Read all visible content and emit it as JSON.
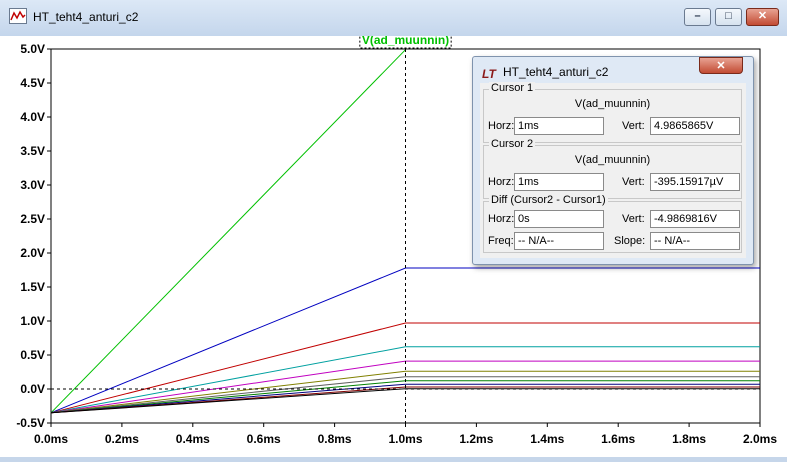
{
  "window": {
    "title": "HT_teht4_anturi_c2",
    "icon": "waveform-icon",
    "minimize_glyph": "–",
    "maximize_glyph": "□",
    "close_glyph": "✕"
  },
  "plot": {
    "trace_label": "V(ad_muunnin)",
    "trace_label_color": "#00c000",
    "cursor_x": 1.0,
    "cursor_y": 0.0
  },
  "chart_data": {
    "type": "line",
    "x_ticks": [
      "0.0ms",
      "0.2ms",
      "0.4ms",
      "0.6ms",
      "0.8ms",
      "1.0ms",
      "1.2ms",
      "1.4ms",
      "1.6ms",
      "1.8ms",
      "2.0ms"
    ],
    "y_ticks": [
      "5.0V",
      "4.5V",
      "4.0V",
      "3.5V",
      "3.0V",
      "2.5V",
      "2.0V",
      "1.5V",
      "1.0V",
      "0.5V",
      "0.0V",
      "-0.5V"
    ],
    "xlim": [
      0,
      2
    ],
    "ylim": [
      -0.5,
      5
    ],
    "x_unit": "ms",
    "y_unit": "V",
    "series": [
      {
        "color": "#00c000",
        "points": [
          [
            0,
            -0.35
          ],
          [
            1.0,
            4.99
          ]
        ]
      },
      {
        "color": "#0000c0",
        "points": [
          [
            0,
            -0.35
          ],
          [
            1.0,
            1.78
          ],
          [
            2.0,
            1.78
          ]
        ]
      },
      {
        "color": "#c00000",
        "points": [
          [
            0,
            -0.35
          ],
          [
            1.0,
            0.97
          ],
          [
            2.0,
            0.97
          ]
        ]
      },
      {
        "color": "#00a0a0",
        "points": [
          [
            0,
            -0.35
          ],
          [
            1.0,
            0.62
          ],
          [
            2.0,
            0.62
          ]
        ]
      },
      {
        "color": "#c000c0",
        "points": [
          [
            0,
            -0.35
          ],
          [
            1.0,
            0.41
          ],
          [
            2.0,
            0.41
          ]
        ]
      },
      {
        "color": "#808000",
        "points": [
          [
            0,
            -0.35
          ],
          [
            1.0,
            0.26
          ],
          [
            2.0,
            0.26
          ]
        ]
      },
      {
        "color": "#606060",
        "points": [
          [
            0,
            -0.35
          ],
          [
            1.0,
            0.18
          ],
          [
            2.0,
            0.18
          ]
        ]
      },
      {
        "color": "#008000",
        "points": [
          [
            0,
            -0.35
          ],
          [
            1.0,
            0.12
          ],
          [
            2.0,
            0.12
          ]
        ]
      },
      {
        "color": "#000080",
        "points": [
          [
            0,
            -0.35
          ],
          [
            1.0,
            0.07
          ],
          [
            2.0,
            0.07
          ]
        ]
      },
      {
        "color": "#800000",
        "points": [
          [
            0,
            -0.35
          ],
          [
            1.0,
            0.03
          ],
          [
            2.0,
            0.03
          ]
        ]
      },
      {
        "color": "#000000",
        "points": [
          [
            0,
            -0.35
          ],
          [
            1.0,
            0.005
          ],
          [
            2.0,
            0.005
          ]
        ]
      }
    ]
  },
  "cursor_dialog": {
    "title": "HT_teht4_anturi_c2",
    "close_glyph": "✕",
    "cursor1": {
      "label": "Cursor 1",
      "trace": "V(ad_muunnin)",
      "horz_label": "Horz:",
      "horz_value": "1ms",
      "vert_label": "Vert:",
      "vert_value": "4.9865865V"
    },
    "cursor2": {
      "label": "Cursor 2",
      "trace": "V(ad_muunnin)",
      "horz_label": "Horz:",
      "horz_value": "1ms",
      "vert_label": "Vert:",
      "vert_value": "-395.15917µV"
    },
    "diff": {
      "label": "Diff (Cursor2 - Cursor1)",
      "horz_label": "Horz:",
      "horz_value": "0s",
      "vert_label": "Vert:",
      "vert_value": "-4.9869816V",
      "freq_label": "Freq:",
      "freq_value": "-- N/A--",
      "slope_label": "Slope:",
      "slope_value": "-- N/A--"
    }
  }
}
